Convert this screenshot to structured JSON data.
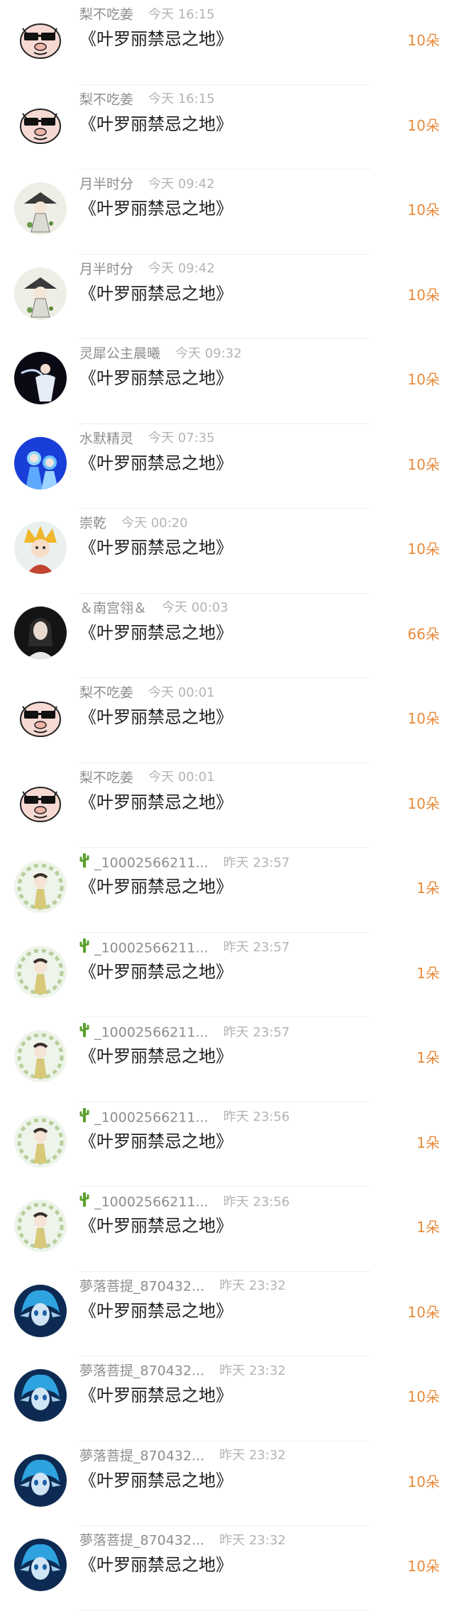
{
  "colors": {
    "accent": "#e88a3a",
    "username": "#8d8d8d",
    "time": "#b4b4b4",
    "title": "#1f1f1f"
  },
  "gifts": [
    {
      "username": "梨不吃姜",
      "time": "今天 16:15",
      "title": "《叶罗丽禁忌之地》",
      "count": "10朵",
      "avatar": "pig-sunglasses"
    },
    {
      "username": "梨不吃姜",
      "time": "今天 16:15",
      "title": "《叶罗丽禁忌之地》",
      "count": "10朵",
      "avatar": "pig-sunglasses"
    },
    {
      "username": "月半时分",
      "time": "今天 09:42",
      "title": "《叶罗丽禁忌之地》",
      "count": "10朵",
      "avatar": "hat-figure"
    },
    {
      "username": "月半时分",
      "time": "今天 09:42",
      "title": "《叶罗丽禁忌之地》",
      "count": "10朵",
      "avatar": "hat-figure"
    },
    {
      "username": "灵犀公主晨曦",
      "time": "今天 09:32",
      "title": "《叶罗丽禁忌之地》",
      "count": "10朵",
      "avatar": "dancer-dark"
    },
    {
      "username": "水默精灵",
      "time": "今天 07:35",
      "title": "《叶罗丽禁忌之地》",
      "count": "10朵",
      "avatar": "blue-fairies"
    },
    {
      "username": "崇乾",
      "time": "今天 00:20",
      "title": "《叶罗丽禁忌之地》",
      "count": "10朵",
      "avatar": "golden-character"
    },
    {
      "username": "＆南宫翎＆",
      "time": "今天 00:03",
      "title": "《叶罗丽禁忌之地》",
      "count": "66朵",
      "avatar": "dark-portrait"
    },
    {
      "username": "梨不吃姜",
      "time": "今天 00:01",
      "title": "《叶罗丽禁忌之地》",
      "count": "10朵",
      "avatar": "pig-sunglasses"
    },
    {
      "username": "梨不吃姜",
      "time": "今天 00:01",
      "title": "《叶罗丽禁忌之地》",
      "count": "10朵",
      "avatar": "pig-sunglasses"
    },
    {
      "username": "_10002566211...",
      "cactus": true,
      "time": "昨天 23:57",
      "title": "《叶罗丽禁忌之地》",
      "count": "1朵",
      "avatar": "floral-girl"
    },
    {
      "username": "_10002566211...",
      "cactus": true,
      "time": "昨天 23:57",
      "title": "《叶罗丽禁忌之地》",
      "count": "1朵",
      "avatar": "floral-girl"
    },
    {
      "username": "_10002566211...",
      "cactus": true,
      "time": "昨天 23:57",
      "title": "《叶罗丽禁忌之地》",
      "count": "1朵",
      "avatar": "floral-girl"
    },
    {
      "username": "_10002566211...",
      "cactus": true,
      "time": "昨天 23:56",
      "title": "《叶罗丽禁忌之地》",
      "count": "1朵",
      "avatar": "floral-girl"
    },
    {
      "username": "_10002566211...",
      "cactus": true,
      "time": "昨天 23:56",
      "title": "《叶罗丽禁忌之地》",
      "count": "1朵",
      "avatar": "floral-girl"
    },
    {
      "username": "夢落菩提_870432...",
      "time": "昨天 23:32",
      "title": "《叶罗丽禁忌之地》",
      "count": "10朵",
      "avatar": "blue-elf"
    },
    {
      "username": "夢落菩提_870432...",
      "time": "昨天 23:32",
      "title": "《叶罗丽禁忌之地》",
      "count": "10朵",
      "avatar": "blue-elf"
    },
    {
      "username": "夢落菩提_870432...",
      "time": "昨天 23:32",
      "title": "《叶罗丽禁忌之地》",
      "count": "10朵",
      "avatar": "blue-elf"
    },
    {
      "username": "夢落菩提_870432...",
      "time": "昨天 23:32",
      "title": "《叶罗丽禁忌之地》",
      "count": "10朵",
      "avatar": "blue-elf"
    }
  ]
}
